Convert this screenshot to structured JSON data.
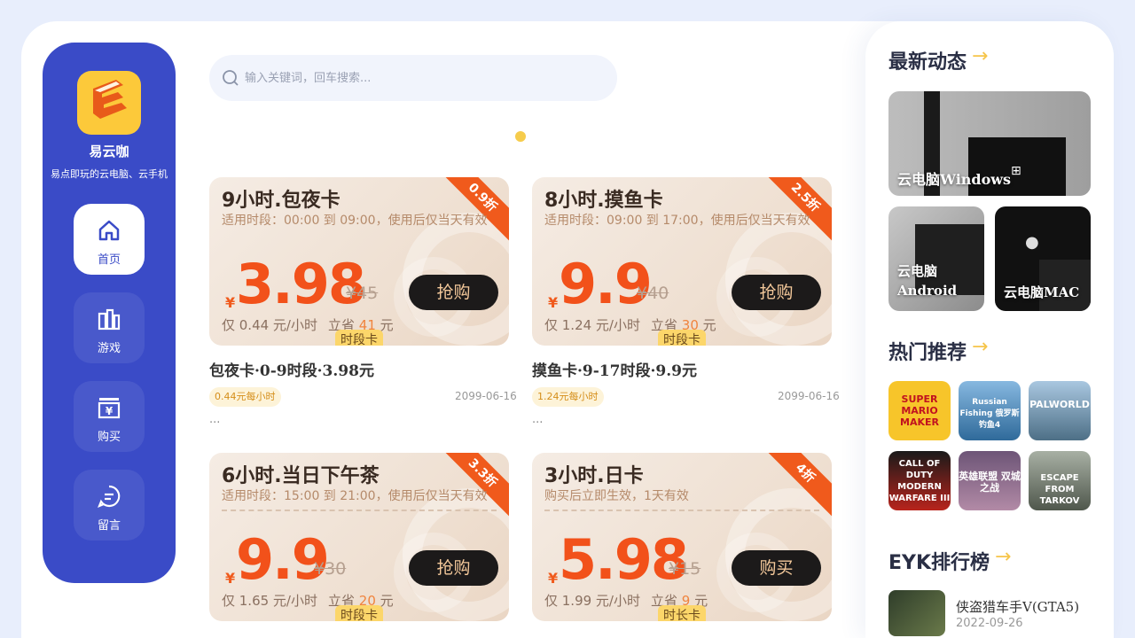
{
  "brand": {
    "name": "易云咖",
    "tagline": "易点即玩的云电脑、云手机"
  },
  "nav": [
    {
      "label": "首页",
      "icon": "home-icon",
      "active": true
    },
    {
      "label": "游戏",
      "icon": "game-icon",
      "active": false
    },
    {
      "label": "购买",
      "icon": "purchase-icon",
      "active": false
    },
    {
      "label": "留言",
      "icon": "message-icon",
      "active": false
    }
  ],
  "search": {
    "placeholder": "输入关键词，回车搜索..."
  },
  "cards": [
    {
      "title": "9小时.包夜卡",
      "subtitle": "适用时段：00:00 到 09:00，使用后仅当天有效",
      "discount": "0.9折",
      "yen": "¥",
      "price": "3.98",
      "old_price": "¥45",
      "button": "抢购",
      "rate": "仅 0.44 元/小时",
      "save_prefix": "立省",
      "save_amount": "41",
      "save_suffix": "元",
      "tag": "时段卡",
      "name": "包夜卡·0-9时段·3.98元",
      "pill": "0.44元每小时",
      "date": "2099-06-16",
      "more": "..."
    },
    {
      "title": "8小时.摸鱼卡",
      "subtitle": "适用时段：09:00 到 17:00，使用后仅当天有效",
      "discount": "2.5折",
      "yen": "¥",
      "price": "9.9",
      "old_price": "¥40",
      "button": "抢购",
      "rate": "仅 1.24 元/小时",
      "save_prefix": "立省",
      "save_amount": "30",
      "save_suffix": "元",
      "tag": "时段卡",
      "name": "摸鱼卡·9-17时段·9.9元",
      "pill": "1.24元每小时",
      "date": "2099-06-16",
      "more": "..."
    },
    {
      "title": "6小时.当日下午茶",
      "subtitle": "适用时段：15:00 到 21:00，使用后仅当天有效",
      "discount": "3.3折",
      "yen": "¥",
      "price": "9.9",
      "old_price": "¥30",
      "button": "抢购",
      "rate": "仅 1.65 元/小时",
      "save_prefix": "立省",
      "save_amount": "20",
      "save_suffix": "元",
      "tag": "时段卡"
    },
    {
      "title": "3小时.日卡",
      "subtitle": "购买后立即生效，1天有效",
      "discount": "4折",
      "yen": "¥",
      "price": "5.98",
      "old_price": "¥15",
      "button": "购买",
      "rate": "仅 1.99 元/小时",
      "save_prefix": "立省",
      "save_amount": "9",
      "save_suffix": "元",
      "tag": "时长卡"
    }
  ],
  "right": {
    "news_title": "最新动态",
    "news_tiles": [
      "云电脑Windows",
      "云电脑\nAndroid",
      "云电脑MAC"
    ],
    "news_android_line1": "云电脑",
    "news_android_line2": "Android",
    "hot_title": "热门推荐",
    "games": [
      {
        "name": "SUPER MARIO MAKER",
        "color": "#f7c52a",
        "icon": "mario-maker-icon"
      },
      {
        "name": "Russian Fishing 俄罗斯钓鱼4",
        "color": "#3d7bb0",
        "icon": "russian-fishing-icon"
      },
      {
        "name": "PALWORLD",
        "color": "#6b8fb0",
        "icon": "palworld-icon"
      },
      {
        "name": "CALL OF DUTY MODERN WARFARE III",
        "color": "#b8241c",
        "icon": "call-of-duty-icon"
      },
      {
        "name": "英雄联盟 双城之战",
        "color": "#8e6b8c",
        "icon": "league-of-legends-icon"
      },
      {
        "name": "ESCAPE FROM TARKOV",
        "color": "#7c8578",
        "icon": "tarkov-icon"
      }
    ],
    "rank_title": "EYK排行榜",
    "rank_item": {
      "name": "侠盗猎车手V(GTA5)",
      "date": "2022-09-26"
    }
  }
}
